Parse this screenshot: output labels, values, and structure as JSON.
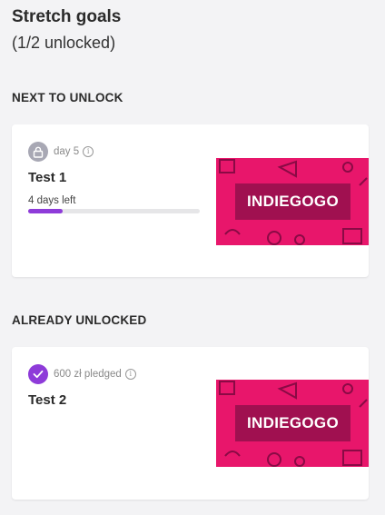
{
  "header": {
    "title": "Stretch goals",
    "subtitle": "(1/2 unlocked)"
  },
  "sections": {
    "next": {
      "label": "NEXT TO UNLOCK",
      "card": {
        "meta": "day 5",
        "title": "Test 1",
        "progress_label": "4 days left",
        "progress_fraction": 0.2,
        "image_logo": "INDIEGOGO",
        "badge_icon": "lock-icon"
      }
    },
    "unlocked": {
      "label": "ALREADY UNLOCKED",
      "card": {
        "meta": "600 zł pledged",
        "title": "Test 2",
        "image_logo": "INDIEGOGO",
        "badge_icon": "check-icon"
      }
    }
  },
  "colors": {
    "accent": "#8e3bd9",
    "image_bg": "#e8166b",
    "logo_band": "#a01050"
  }
}
